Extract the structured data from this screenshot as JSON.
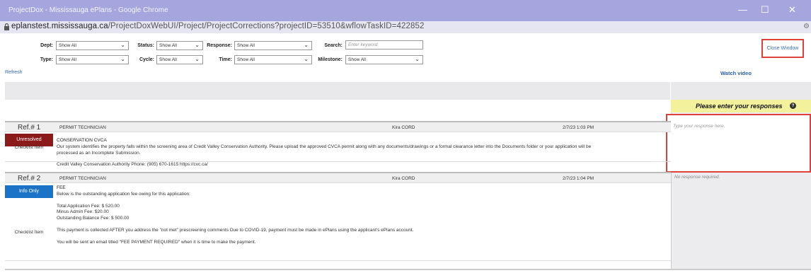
{
  "window": {
    "title": "ProjectDox - Mississauga ePlans - Google Chrome",
    "minimize": "—",
    "maximize": "☐",
    "close": "✕"
  },
  "address": {
    "domain": "eplanstest.mississauga.ca",
    "path": "/ProjectDoxWebUI/Project/ProjectCorrections?projectID=53510&wflowTaskID=422852"
  },
  "filters": {
    "dept": {
      "label": "Dept:",
      "value": "Show All"
    },
    "type": {
      "label": "Type:",
      "value": "Show All"
    },
    "status": {
      "label": "Status:",
      "value": "Show All"
    },
    "cycle": {
      "label": "Cycle:",
      "value": "Show All"
    },
    "response": {
      "label": "Response:",
      "value": "Show All"
    },
    "time": {
      "label": "Time:",
      "value": "Show All"
    },
    "search": {
      "label": "Search:",
      "placeholder": "Enter keyword"
    },
    "milestone": {
      "label": "Milestone:",
      "value": "Show All"
    }
  },
  "actions": {
    "close_window": "Close Window",
    "refresh": "Refresh",
    "watch_video": "Watch video"
  },
  "response_panel": {
    "header": "Please enter your responses",
    "help_icon": "?",
    "placeholder": "Type your response here.",
    "no_response": "No response required."
  },
  "comments": [
    {
      "ref": "Ref.# 1",
      "reviewer": "PERMIT TECHNICIAN",
      "author": "Kira CORD",
      "date": "2/7/23 1:03 PM",
      "status": "Unresolved",
      "status_color": "#8b1a1a",
      "type": "Checklist Item",
      "title": "CONSERVATION CVCA",
      "lines": [
        "Our system identifies the property falls within the screening area of Credit Valley Conservation Authority. Please upload the approved CVCA permit along with any documents/drawings or a formal clearance letter into the Documents folder or your application will be",
        "processed as an Incomplete Submission.",
        "",
        "Credit Valley Conservation Authority Phone: (905) 670-1615 https://cvc.ca/"
      ]
    },
    {
      "ref": "Ref.# 2",
      "reviewer": "PERMIT TECHNICIAN",
      "author": "Kira CORD",
      "date": "2/7/23 1:04 PM",
      "status": "Info Only",
      "status_color": "#1b73c7",
      "type": "Checklist Item",
      "title": "FEE",
      "lines": [
        "Below is the outstanding application fee owing for this application:",
        "",
        "Total Application Fee: $ 520.00",
        "Minus Admin Fee: $20.00",
        "Outstanding Balance Fee: $ 500.00",
        "",
        "This payment is collected AFTER you address the \"not met\" prescreening comments Due to COVID-19, payment must be made in ePlans using the applicant's ePlans account.",
        "",
        "You will be sent an email titled \"FEE PAYMENT REQUIRED\" when it is time to make the payment."
      ]
    }
  ]
}
